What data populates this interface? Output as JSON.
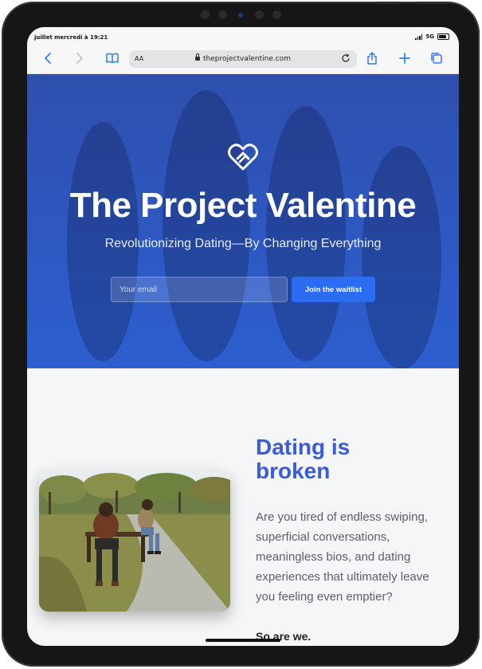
{
  "status": {
    "time": "juillet mercredi à 19:21",
    "network": "5G"
  },
  "browser": {
    "text_size_label": "AA",
    "url": "theprojectvalentine.com"
  },
  "hero": {
    "title": "The Project Valentine",
    "subtitle": "Revolutionizing Dating—By Changing Everything",
    "email_placeholder": "Your email",
    "cta_label": "Join the waitlist"
  },
  "section": {
    "title_line1": "Dating is",
    "title_line2": "broken",
    "body": "Are you tired of endless swiping, superficial conversations, meaningless bios, and dating experiences that ultimately leave you feeling even emptier?",
    "footer": "So are we."
  },
  "colors": {
    "hero_bg": "#2d5fd0",
    "cta_bg": "#2b6cf2",
    "title_accent": "#3b5bdb",
    "safari_blue": "#2f7bf5"
  },
  "icons": [
    "back-icon",
    "forward-icon",
    "bookmarks-icon",
    "lock-icon",
    "reload-icon",
    "share-icon",
    "new-tab-icon",
    "tabs-icon",
    "heart-logo-icon"
  ]
}
